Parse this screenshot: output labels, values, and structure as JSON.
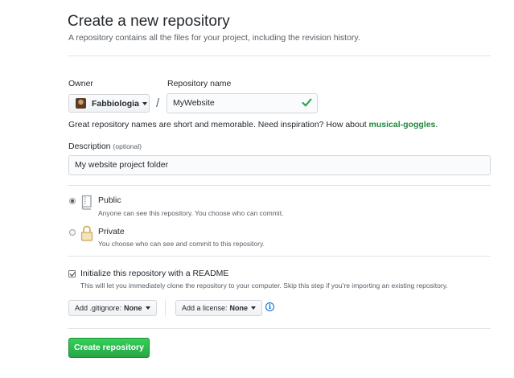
{
  "header": {
    "title": "Create a new repository",
    "subtitle": "A repository contains all the files for your project, including the revision history."
  },
  "owner": {
    "label": "Owner",
    "value": "Fabbiologia"
  },
  "separator": "/",
  "repo_name": {
    "label": "Repository name",
    "value": "MyWebsite",
    "valid": true
  },
  "hint": {
    "prefix": "Great repository names are short and memorable. Need inspiration? How about ",
    "suggestion": "musical-goggles",
    "suffix": "."
  },
  "description": {
    "label": "Description",
    "optional": "(optional)",
    "value": "My website project folder"
  },
  "visibility": {
    "selected": "public",
    "public": {
      "title": "Public",
      "desc": "Anyone can see this repository. You choose who can commit."
    },
    "private": {
      "title": "Private",
      "desc": "You choose who can see and commit to this repository."
    }
  },
  "readme": {
    "checked": true,
    "title": "Initialize this repository with a README",
    "desc": "This will let you immediately clone the repository to your computer. Skip this step if you’re importing an existing repository."
  },
  "gitignore": {
    "label": "Add .gitignore:",
    "value": "None"
  },
  "license": {
    "label": "Add a license:",
    "value": "None"
  },
  "info_icon": "i",
  "submit": {
    "label": "Create repository"
  },
  "colors": {
    "accent_green": "#28a745",
    "link_blue": "#0366d6",
    "suggestion_green": "#22863a",
    "valid_check": "#28a745"
  }
}
